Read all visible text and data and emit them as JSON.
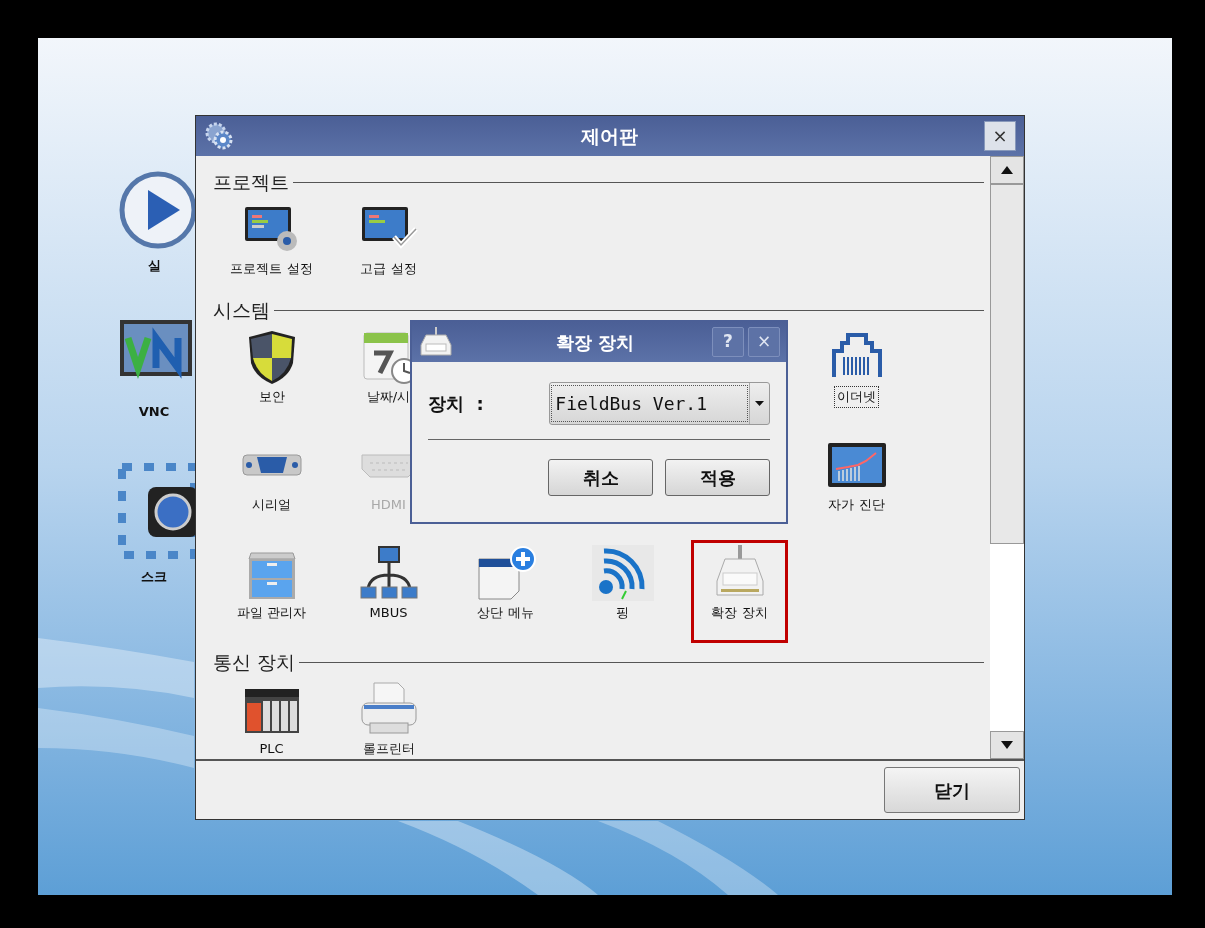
{
  "desktop": {
    "icons": [
      {
        "kind": "play",
        "label": "실"
      },
      {
        "kind": "vnc",
        "label": "VNC"
      },
      {
        "kind": "screen",
        "label": "스크"
      }
    ]
  },
  "window": {
    "title": "제어판",
    "close": "×",
    "close_button": "닫기",
    "sections": [
      {
        "title": "프로젝트",
        "rows": [
          {
            "leading": [
              {
                "kind": "monitor-gear",
                "label": "프로젝트 설정",
                "selected": false,
                "disabled": false,
                "focused": false
              },
              {
                "kind": "monitor-check",
                "label": "고급 설정",
                "selected": false,
                "disabled": false,
                "focused": false
              }
            ],
            "trailing": []
          }
        ]
      },
      {
        "title": "시스템",
        "rows": [
          {
            "leading": [
              {
                "kind": "shield",
                "label": "보안",
                "selected": false,
                "disabled": false,
                "focused": false
              },
              {
                "kind": "calendar-clock",
                "label": "날짜/시",
                "selected": false,
                "disabled": false,
                "focused": false
              }
            ],
            "trailing": [
              {
                "kind": "ethernet",
                "label": "이더넷",
                "selected": false,
                "disabled": false,
                "focused": true
              }
            ]
          },
          {
            "leading": [
              {
                "kind": "serial",
                "label": "시리얼",
                "selected": false,
                "disabled": false,
                "focused": false
              },
              {
                "kind": "hdmi",
                "label": "HDMI",
                "selected": false,
                "disabled": true,
                "focused": false
              }
            ],
            "trailing": [
              {
                "kind": "chart",
                "label": "자가 진단",
                "selected": false,
                "disabled": false,
                "focused": false
              }
            ]
          },
          {
            "leading": [
              {
                "kind": "cabinet",
                "label": "파일 관리자",
                "selected": false,
                "disabled": false,
                "focused": false
              },
              {
                "kind": "network",
                "label": "MBUS",
                "selected": false,
                "disabled": false,
                "focused": false
              },
              {
                "kind": "calendar-plus",
                "label": "상단 메뉴",
                "selected": false,
                "disabled": false,
                "focused": false
              },
              {
                "kind": "ping",
                "label": "핑",
                "selected": false,
                "disabled": false,
                "focused": false
              },
              {
                "kind": "ext",
                "label": "확장 장치",
                "selected": true,
                "disabled": false,
                "focused": false
              }
            ],
            "trailing": []
          }
        ]
      },
      {
        "title": "통신 장치",
        "rows": [
          {
            "leading": [
              {
                "kind": "plc",
                "label": "PLC",
                "selected": false,
                "disabled": false,
                "focused": false
              },
              {
                "kind": "printer",
                "label": "롤프린터",
                "selected": false,
                "disabled": false,
                "focused": false
              }
            ],
            "trailing": []
          }
        ]
      }
    ]
  },
  "dialog": {
    "title": "확장 장치",
    "help": "?",
    "close": "×",
    "field_label": "장치  :",
    "select": {
      "value": "FieldBus Ver.1"
    },
    "buttons": [
      "취소",
      "적용"
    ]
  }
}
